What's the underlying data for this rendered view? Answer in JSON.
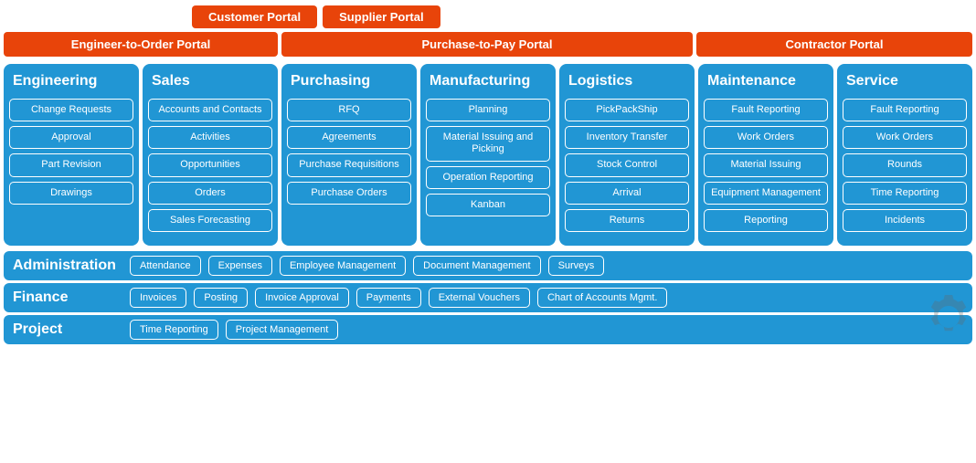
{
  "topPortals": [
    {
      "label": "Customer Portal"
    },
    {
      "label": "Supplier Portal"
    }
  ],
  "widePortals": [
    {
      "label": "Engineer-to-Order Portal",
      "class": "portal-eto"
    },
    {
      "label": "Purchase-to-Pay Portal",
      "class": "portal-ptp"
    },
    {
      "label": "Contractor Portal",
      "class": "portal-contractor"
    }
  ],
  "columns": [
    {
      "title": "Engineering",
      "items": [
        "Change Requests",
        "Approval",
        "Part Revision",
        "Drawings"
      ]
    },
    {
      "title": "Sales",
      "items": [
        "Accounts and Contacts",
        "Activities",
        "Opportunities",
        "Orders",
        "Sales Forecasting"
      ]
    },
    {
      "title": "Purchasing",
      "items": [
        "RFQ",
        "Agreements",
        "Purchase Requisitions",
        "Purchase Orders"
      ]
    },
    {
      "title": "Manufacturing",
      "items": [
        "Planning",
        "Material Issuing and Picking",
        "Operation Reporting",
        "Kanban"
      ]
    },
    {
      "title": "Logistics",
      "items": [
        "PickPackShip",
        "Inventory Transfer",
        "Stock Control",
        "Arrival",
        "Returns"
      ]
    },
    {
      "title": "Maintenance",
      "items": [
        "Fault Reporting",
        "Work Orders",
        "Material Issuing",
        "Equipment Management",
        "Reporting"
      ]
    },
    {
      "title": "Service",
      "items": [
        "Fault Reporting",
        "Work Orders",
        "Rounds",
        "Time Reporting",
        "Incidents"
      ]
    }
  ],
  "bottomRows": [
    {
      "title": "Administration",
      "items": [
        "Attendance",
        "Expenses",
        "Employee Management",
        "Document Management",
        "Surveys"
      ]
    },
    {
      "title": "Finance",
      "items": [
        "Invoices",
        "Posting",
        "Invoice Approval",
        "Payments",
        "External Vouchers",
        "Chart of Accounts Mgmt."
      ]
    },
    {
      "title": "Project",
      "items": [
        "Time Reporting",
        "Project Management"
      ]
    }
  ]
}
